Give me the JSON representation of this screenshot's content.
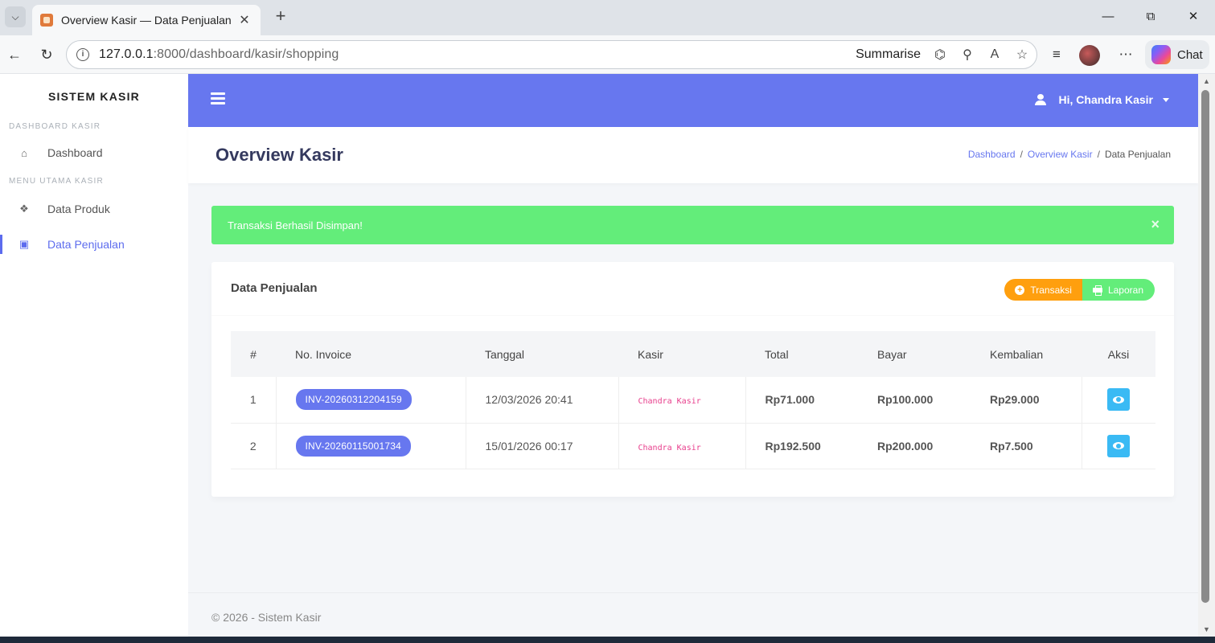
{
  "browser": {
    "tab_title": "Overview Kasir — Data Penjualan",
    "tab_close": "✕",
    "new_tab": "+",
    "url_host": "127.0.0.1",
    "url_rest": ":8000/dashboard/kasir/shopping",
    "summarise_label": "Summarise",
    "chat_label": "Chat",
    "controls": {
      "minimize": "—",
      "restore": "⧉",
      "close": "✕"
    }
  },
  "sidebar": {
    "brand": "SISTEM KASIR",
    "sections": [
      {
        "heading": "DASHBOARD KASIR",
        "items": [
          {
            "label": "Dashboard",
            "icon": "home-icon"
          }
        ]
      },
      {
        "heading": "MENU UTAMA KASIR",
        "items": [
          {
            "label": "Data Produk",
            "icon": "cubes-icon"
          },
          {
            "label": "Data Penjualan",
            "icon": "money-icon",
            "active": true
          }
        ]
      }
    ]
  },
  "topbar": {
    "user_label": "Hi, Chandra Kasir",
    "accent": "#6777ef"
  },
  "header": {
    "title": "Overview Kasir",
    "breadcrumb": [
      "Dashboard",
      "Overview Kasir",
      "Data Penjualan"
    ],
    "breadcrumb_sep": "/"
  },
  "alert": {
    "message": "Transaksi Berhasil Disimpan!",
    "close": "×",
    "color": "#63ed7a"
  },
  "card": {
    "title": "Data Penjualan",
    "buttons": {
      "transaksi": "Transaksi",
      "laporan": "Laporan"
    }
  },
  "table": {
    "columns": [
      "#",
      "No. Invoice",
      "Tanggal",
      "Kasir",
      "Total",
      "Bayar",
      "Kembalian",
      "Aksi"
    ],
    "rows": [
      {
        "no": "1",
        "invoice": "INV-20260312204159",
        "tanggal": "12/03/2026 20:41",
        "kasir": "Chandra Kasir",
        "total": "Rp71.000",
        "bayar": "Rp100.000",
        "kembalian": "Rp29.000"
      },
      {
        "no": "2",
        "invoice": "INV-20260115001734",
        "tanggal": "15/01/2026 00:17",
        "kasir": "Chandra Kasir",
        "total": "Rp192.500",
        "bayar": "Rp200.000",
        "kembalian": "Rp7.500"
      }
    ]
  },
  "footer": {
    "text": "© 2026 - Sistem Kasir"
  }
}
